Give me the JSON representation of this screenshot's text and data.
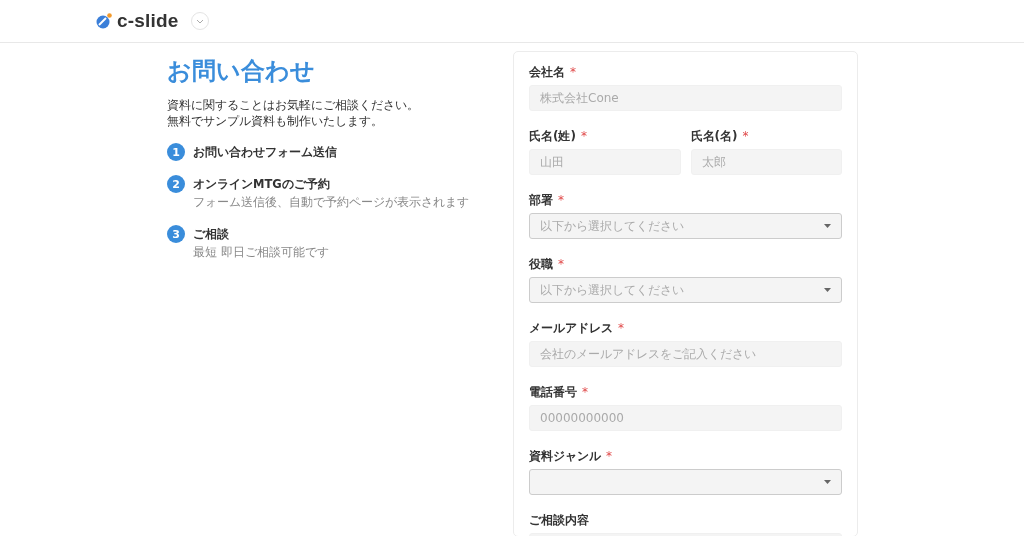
{
  "header": {
    "logo_text": "c-slide"
  },
  "intro": {
    "title": "お問い合わせ",
    "description": [
      "資料に関することはお気軽にご相談ください。",
      "無料でサンプル資料も制作いたします。"
    ],
    "steps": [
      {
        "number": "1",
        "title": "お問い合わせフォーム送信"
      },
      {
        "number": "2",
        "title": "オンラインMTGのご予約",
        "note": "フォーム送信後、自動で予約ページが表示されます"
      },
      {
        "number": "3",
        "title": "ご相談",
        "note": "最短 即日ご相談可能です"
      }
    ]
  },
  "form": {
    "rows": [
      [
        {
          "kind": "text",
          "label": "会社名",
          "required_mark": "*",
          "placeholder": "株式会社Cone"
        }
      ],
      [
        {
          "kind": "text",
          "label": "氏名(姓)",
          "required_mark": "*",
          "placeholder": "山田"
        },
        {
          "kind": "text",
          "label": "氏名(名)",
          "required_mark": "*",
          "placeholder": "太郎"
        }
      ],
      [
        {
          "kind": "select",
          "label": "部署",
          "required_mark": "*",
          "placeholder": "以下から選択してください"
        }
      ],
      [
        {
          "kind": "select",
          "label": "役職",
          "required_mark": "*",
          "placeholder": "以下から選択してください"
        }
      ],
      [
        {
          "kind": "text",
          "label": "メールアドレス",
          "required_mark": "*",
          "placeholder": "会社のメールアドレスをご記入ください"
        }
      ],
      [
        {
          "kind": "text",
          "label": "電話番号",
          "required_mark": "*",
          "placeholder": "00000000000"
        }
      ],
      [
        {
          "kind": "select",
          "label": "資料ジャンル",
          "required_mark": "*"
        }
      ],
      [
        {
          "kind": "textarea",
          "label": "ご相談内容"
        }
      ]
    ]
  }
}
